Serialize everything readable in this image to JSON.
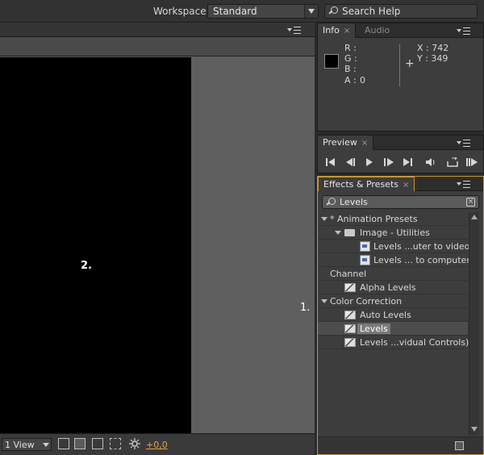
{
  "header": {
    "workspace_label": "Workspace:",
    "workspace_value": "Standard",
    "search_help_placeholder": "Search Help"
  },
  "composition": {
    "canvas_annotation": "2.",
    "view_select_value": "1 View",
    "timecode": "+0,0"
  },
  "annotations": {
    "marker_1": "1."
  },
  "info_panel": {
    "tabs": [
      "Info",
      "Audio"
    ],
    "close_glyph": "×",
    "r_label": "R :",
    "g_label": "G :",
    "b_label": "B :",
    "a_label": "A :",
    "a_value": "0",
    "x_label": "X : 742",
    "y_label": "Y : 349",
    "swatch_color": "#000000"
  },
  "preview_panel": {
    "tab": "Preview",
    "close_glyph": "×"
  },
  "effects_panel": {
    "tab": "Effects & Presets",
    "close_glyph": "×",
    "search_value": "Levels",
    "clear_glyph": "×",
    "tree": [
      {
        "label": "* Animation Presets",
        "level": 0,
        "type": "category"
      },
      {
        "label": "Image - Utilities",
        "level": 1,
        "type": "folder"
      },
      {
        "label": "Levels ...uter to video",
        "level": 2,
        "type": "preset"
      },
      {
        "label": "Levels ... to computer",
        "level": 2,
        "type": "preset"
      },
      {
        "label": "Channel",
        "level": 0,
        "type": "category-plain"
      },
      {
        "label": "Alpha Levels",
        "level": 1,
        "type": "effect"
      },
      {
        "label": "Color Correction",
        "level": 0,
        "type": "category"
      },
      {
        "label": "Auto Levels",
        "level": 1,
        "type": "effect"
      },
      {
        "label": "Levels",
        "level": 1,
        "type": "effect",
        "selected": true
      },
      {
        "label": "Levels ...vidual Controls)",
        "level": 1,
        "type": "effect"
      }
    ]
  },
  "colors": {
    "accent_highlight": "#c9962a",
    "timecode_color": "#e8a23b"
  }
}
